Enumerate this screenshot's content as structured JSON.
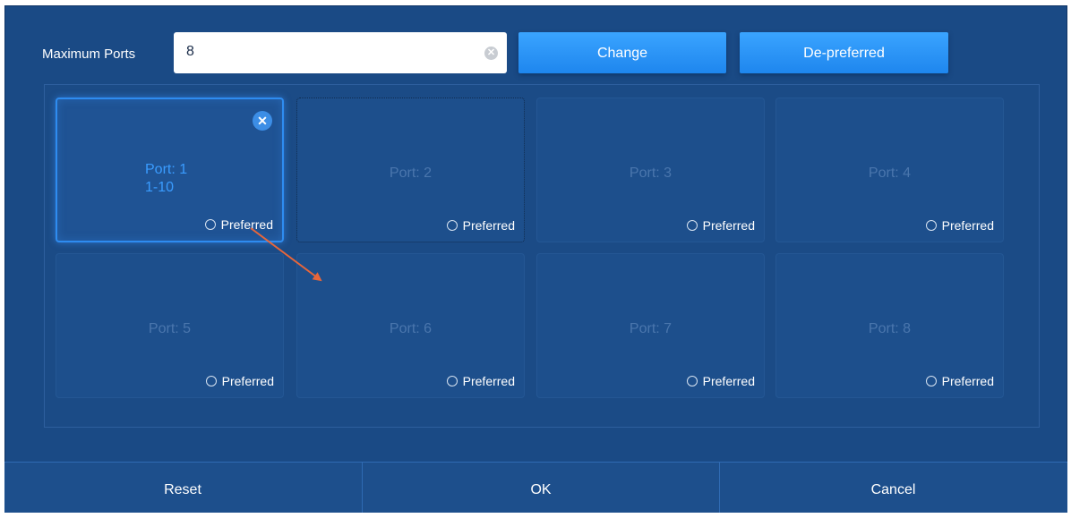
{
  "header": {
    "max_ports_label": "Maximum Ports",
    "max_ports_value": "8",
    "change_label": "Change",
    "depreferred_label": "De-preferred"
  },
  "ports": [
    {
      "label": "Port: 1",
      "range": "1-10",
      "preferred_label": "Preferred",
      "active": true
    },
    {
      "label": "Port: 2",
      "preferred_label": "Preferred"
    },
    {
      "label": "Port: 3",
      "preferred_label": "Preferred"
    },
    {
      "label": "Port: 4",
      "preferred_label": "Preferred"
    },
    {
      "label": "Port: 5",
      "preferred_label": "Preferred"
    },
    {
      "label": "Port: 6",
      "preferred_label": "Preferred"
    },
    {
      "label": "Port: 7",
      "preferred_label": "Preferred"
    },
    {
      "label": "Port: 8",
      "preferred_label": "Preferred"
    }
  ],
  "footer": {
    "reset_label": "Reset",
    "ok_label": "OK",
    "cancel_label": "Cancel"
  },
  "icons": {
    "clear": "clear-circle-icon",
    "remove": "close-icon",
    "radio": "radio-unchecked-icon"
  },
  "colors": {
    "background": "#1a4a85",
    "accent": "#2e8cf0",
    "active_text": "#3a9cff",
    "annotation_arrow": "#e8663a"
  }
}
